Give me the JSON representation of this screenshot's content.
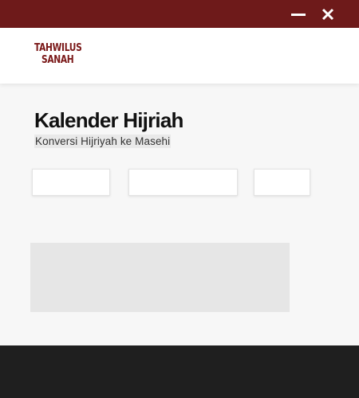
{
  "window": {
    "titlebar_color": "#6e1a1a",
    "minimize_icon": "minimize-icon",
    "close_icon": "close-icon"
  },
  "header": {
    "logo_line1": "TAHWILUS",
    "logo_line2": "SANAH",
    "logo_color": "#7a1818"
  },
  "main": {
    "title": "Kalender Hijriah",
    "subtitle": "Konversi Hijriyah ke Masehi",
    "fields": {
      "day_value": "",
      "month_value": "",
      "year_value": ""
    },
    "result_text": ""
  },
  "footer": {
    "background": "#1f1f1f"
  }
}
